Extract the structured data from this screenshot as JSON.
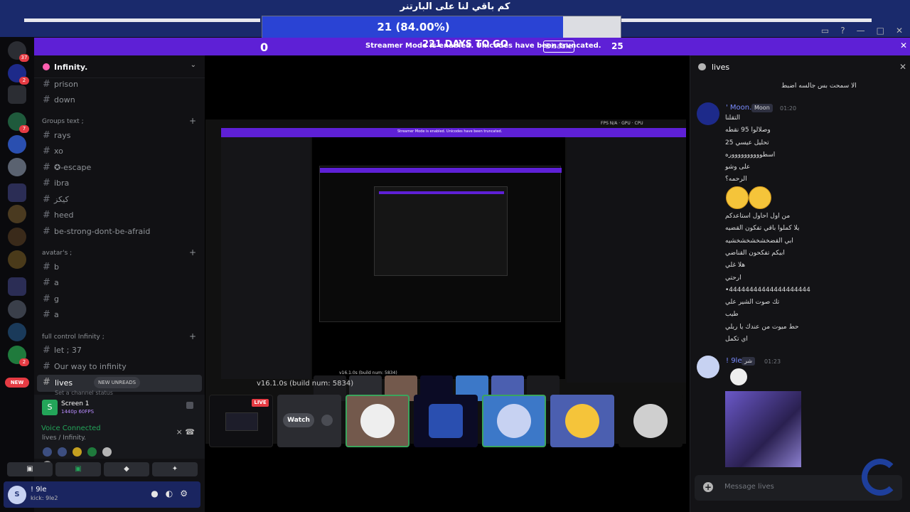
{
  "overlay": {
    "title": "كم باقي لنا على البارتنر",
    "progress_text": "21 (84.00%)",
    "progress_fraction": 0.84,
    "countdown_left": "0",
    "countdown_text": "221 DAYS TO GO",
    "countdown_right": "25",
    "bar_color": "#2a43d4"
  },
  "banner": {
    "text": "Streamer Mode is enabled. Unicodes have been truncated.",
    "disable_label": "Disable",
    "color": "#5e20d6"
  },
  "guilds": {
    "badges": [
      "37",
      "2",
      "7",
      "2"
    ],
    "new_label": "NEW"
  },
  "server": {
    "name": "Infinity.",
    "channels_top": [
      "prison",
      "down"
    ],
    "categories": [
      {
        "name": "Groups text ;",
        "channels": [
          "rays",
          "xo",
          "✪-escape",
          "ibra",
          "كيكز",
          "heed",
          "be-strong-dont-be-afraid"
        ]
      },
      {
        "name": "avatar's ;",
        "channels": [
          "b",
          "a",
          "g",
          "a"
        ]
      },
      {
        "name": "full control Infinity ;",
        "channels": [
          "let ; 37",
          "Our way to infinity"
        ]
      }
    ],
    "active_channel": {
      "name": "lives",
      "new_unreads": "NEW UNREADS",
      "topic": "Set a channel status"
    }
  },
  "voice": {
    "screen_title": "Screen 1",
    "screen_sub": "1440p 60FPS",
    "status": "Voice Connected",
    "location": "lives / Infinity."
  },
  "user": {
    "name": "! 9le",
    "sub": "kick: 9le2"
  },
  "stage": {
    "build": "v16.1.0s (build num: 5834)",
    "live_badge": "LIVE",
    "watch_label": "Watch"
  },
  "chat": {
    "title": "lives",
    "messages_top": [
      "الا سمحت بس جالسه اضبط"
    ],
    "moon": {
      "name": "' Moon.",
      "tag": "Moon",
      "time": "01:20",
      "lines": [
        "التقلنا",
        "وصلالوا 95 نقطه",
        "25 تحليل عيسي",
        "اسطووووووووووره",
        "على وشو",
        "الرحمه؟",
        "من اول احاول استاعدكم",
        "يلا كملوا باقي تفكون القضيه",
        "ابي القضخشخشخشخشيه",
        "ابيكم تفكحون القناضي",
        "هلا غلي",
        "ارحتي",
        "•44444444444444444444",
        "تك صوت الشير علي",
        "طيب",
        "حط ميوت من عندك يا ربلي",
        "اي تكمل"
      ]
    },
    "nine": {
      "name": "! 9le",
      "tag": "شر",
      "time": "01:23"
    },
    "input_placeholder": "Message lives"
  }
}
